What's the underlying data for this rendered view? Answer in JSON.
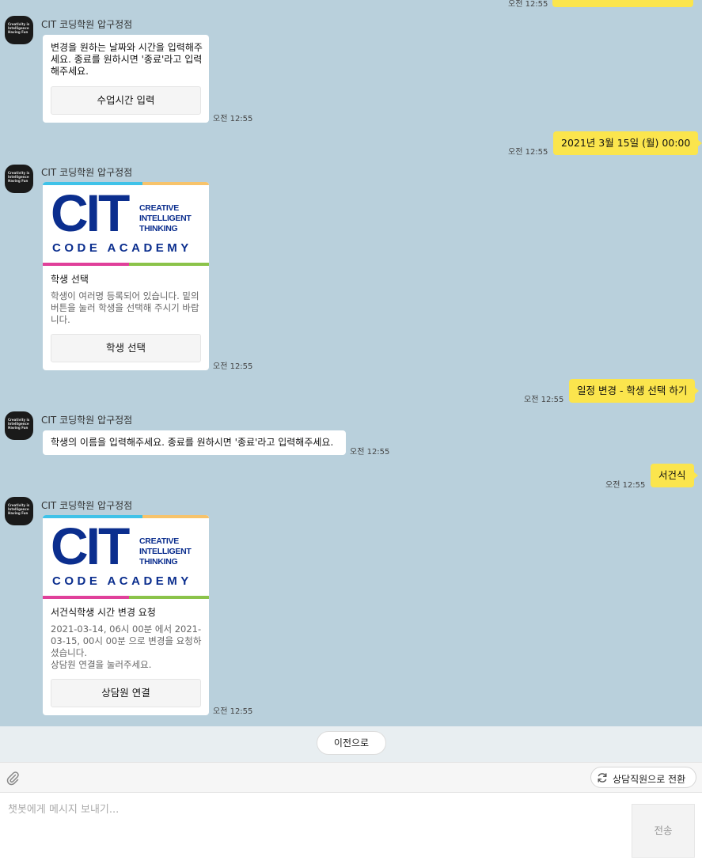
{
  "bot": {
    "name": "CIT 코딩학원 압구정점",
    "avatar_text": "Creativity is Intelligence Having Fun"
  },
  "logo": {
    "brand": "CIT",
    "tagline_1": "CREATIVE",
    "tagline_2": "INTELLIGENT",
    "tagline_3": "THINKING",
    "academy": "CODE ACADEMY"
  },
  "messages": {
    "top_out_time": "오전 12:55",
    "m1": {
      "text": "변경을 원하는 날짜와 시간을 입력해주세요. 종료를 원하시면 '종료'라고 입력해주세요.",
      "button": "수업시간 입력",
      "time": "오전 12:55"
    },
    "o1": {
      "text": "2021년 3월 15일 (월) 00:00",
      "time": "오전 12:55"
    },
    "m2": {
      "title": "학생 선택",
      "desc": "학생이 여러명 등록되어 있습니다. 밑의 버튼을 눌러 학생을 선택해 주시기 바랍니다.",
      "button": "학생 선택",
      "time": "오전 12:55"
    },
    "o2": {
      "text": "일정 변경 - 학생 선택 하기",
      "time": "오전 12:55"
    },
    "m3": {
      "text": "학생의 이름을 입력해주세요. 종료를 원하시면 '종료'라고 입력해주세요.",
      "time": "오전 12:55"
    },
    "o3": {
      "text": "서건식",
      "time": "오전 12:55"
    },
    "m4": {
      "title": "서건식학생 시간 변경 요청",
      "desc": "2021-03-14, 06시 00분 에서 2021-03-15, 00시 00분 으로 변경을 요청하셨습니다.\n상담원 연결을 눌러주세요.",
      "button": "상담원 연결",
      "time": "오전 12:55"
    }
  },
  "controls": {
    "prev": "이전으로",
    "switch_agent": "상담직원으로 전환",
    "input_placeholder": "챗봇에게 메시지 보내기...",
    "send": "전송"
  },
  "colors": {
    "chat_bg": "#b9d0dc",
    "bubble_out": "#fbe54d",
    "brand_blue": "#0b2e8e"
  }
}
